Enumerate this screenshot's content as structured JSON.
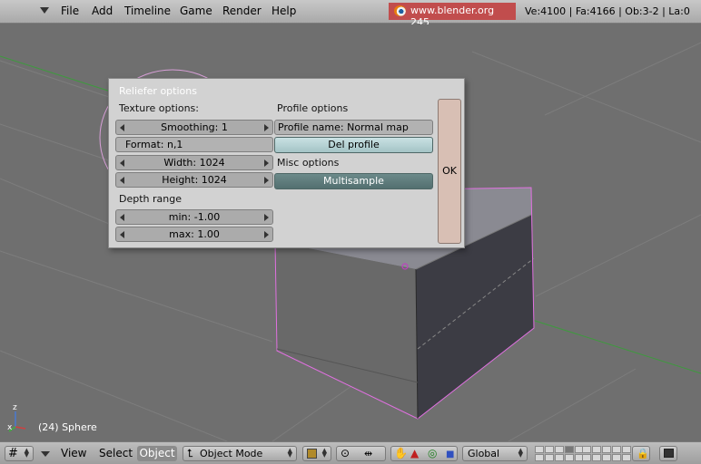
{
  "menubar": {
    "items": [
      "File",
      "Add",
      "Timeline",
      "Game",
      "Render",
      "Help"
    ],
    "site": "www.blender.org 245",
    "stats": "Ve:4100 | Fa:4166 | Ob:3-2 | La:0"
  },
  "viewport": {
    "object_label": "(24) Sphere",
    "axis_z": "z",
    "axis_x": "x"
  },
  "dialog": {
    "title": "Reliefer options",
    "texture_label": "Texture options:",
    "smoothing": "Smoothing:  1",
    "format": "Format:  n,1",
    "width": "Width:  1024",
    "height": "Height:  1024",
    "depth_label": "Depth range",
    "min": "min:  -1.00",
    "max": "max:  1.00",
    "profile_label": "Profile options",
    "profile_name": "Profile name:  Normal map",
    "del_profile": "Del profile",
    "misc_label": "Misc options",
    "multisample": "Multisample",
    "ok": "OK"
  },
  "bottombar": {
    "view": "View",
    "select": "Select",
    "object": "Object",
    "mode": "Object Mode",
    "orientation": "Global"
  }
}
